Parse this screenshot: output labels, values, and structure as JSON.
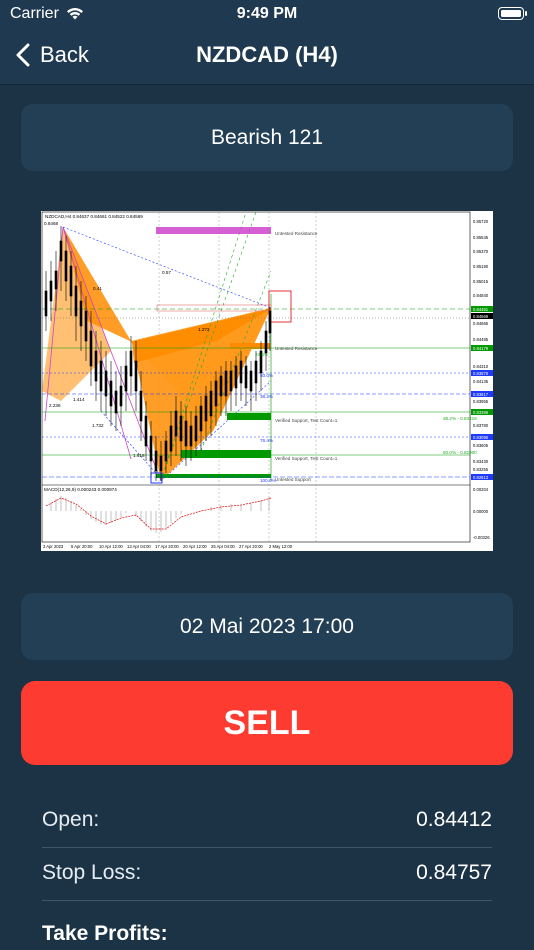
{
  "status": {
    "carrier": "Carrier",
    "time": "9:49 PM"
  },
  "nav": {
    "back_label": "Back",
    "title": "NZDCAD (H4)"
  },
  "pattern": {
    "name": "Bearish 121"
  },
  "chart_image": {
    "header": "NZDCAD,H4 0.84637 0.84661 0.84522 0.84569",
    "top_price_label": "0.8468",
    "price_ticks": [
      "0.85720",
      "0.85545",
      "0.85370",
      "0.85190",
      "0.85015",
      "0.84840",
      "0.84665",
      "0.84485",
      "0.84310",
      "0.84135",
      "0.83955",
      "0.83780",
      "0.83605",
      "0.83430",
      "0.83255",
      "0.83075",
      "0.82900",
      "0.82720",
      "0.82545",
      "0.00204",
      "0.00000",
      "-0.00326"
    ],
    "price_badges": [
      "0.84461",
      "0.84569",
      "0.84179",
      "0.83879",
      "0.83617",
      "0.83396",
      "0.83096",
      "0.82613"
    ],
    "time_labels": [
      "3 Apr 2023",
      "5 Apr 20:00",
      "10 Apr 12:00",
      "13 Apr 04:00",
      "17 Apr 20:00",
      "20 Apr 12:00",
      "25 Apr 04:00",
      "27 Apr 20:00",
      "2 May 12:00"
    ],
    "zone_labels": [
      "Untested Resistance",
      "Untested Resistance",
      "Verified Support, Test Count=1",
      "Verified Support, Test Count=1",
      "Untested Support"
    ],
    "fib_labels": [
      "0.57",
      "0.41",
      "1.272",
      "23.6%",
      "1.414",
      "2.236",
      "1.732",
      "1.618",
      "38.2%",
      "76.4%",
      "50.0%",
      "100.0%"
    ],
    "right_fib_labels": [
      "38.2% - 0.83319",
      "50.0% - 0.82900"
    ],
    "macd_label": "MACD(12,26,9) 0.000243 0.000974",
    "colors": {
      "orange": "#ff8c00",
      "green": "#008000",
      "magenta": "#cc44cc",
      "blue": "#1e3aff",
      "red": "#e00000"
    }
  },
  "signal": {
    "date": "02 Mai 2023 17:00",
    "action": "SELL",
    "action_color": "#fd3b30"
  },
  "levels": {
    "open_label": "Open:",
    "open_value": "0.84412",
    "stop_label": "Stop Loss:",
    "stop_value": "0.84757",
    "tp_label": "Take Profits:"
  }
}
